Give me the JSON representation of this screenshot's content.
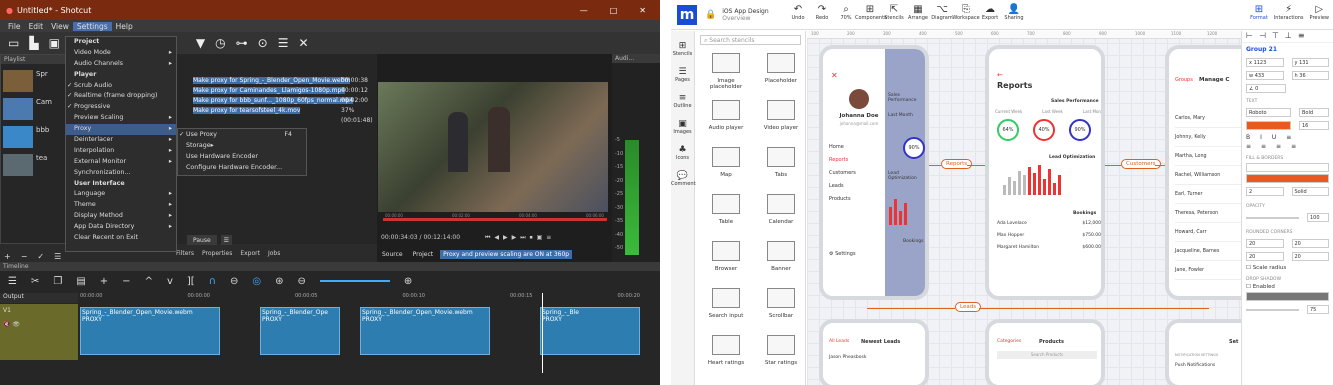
{
  "shotcut": {
    "title": "Untitled* - Shotcut",
    "menu": [
      "File",
      "Edit",
      "View",
      "Settings",
      "Help"
    ],
    "settings_menu": [
      {
        "label": "Project",
        "bold": true
      },
      {
        "label": "Video Mode",
        "arrow": true
      },
      {
        "label": "Audio Channels",
        "arrow": true
      },
      {
        "label": "Player",
        "bold": true
      },
      {
        "label": "Scrub Audio",
        "check": true
      },
      {
        "label": "Realtime (frame dropping)",
        "check": true
      },
      {
        "label": "Progressive",
        "check": true
      },
      {
        "label": "Preview Scaling",
        "arrow": true
      },
      {
        "label": "Proxy",
        "arrow": true,
        "selected": true
      },
      {
        "label": "Deinterlacer",
        "arrow": true
      },
      {
        "label": "Interpolation",
        "arrow": true
      },
      {
        "label": "External Monitor",
        "arrow": true
      },
      {
        "label": "Synchronization..."
      },
      {
        "label": "User Interface",
        "bold": true
      },
      {
        "label": "Language",
        "arrow": true
      },
      {
        "label": "Theme",
        "arrow": true
      },
      {
        "label": "Display Method",
        "arrow": true
      },
      {
        "label": "App Data Directory",
        "arrow": true
      },
      {
        "label": "Clear Recent on Exit"
      }
    ],
    "proxy_submenu": [
      {
        "label": "Use Proxy",
        "shortcut": "F4",
        "check": true
      },
      {
        "label": "Storage",
        "arrow": true,
        "selected": true
      },
      {
        "label": "Use Hardware Encoder"
      },
      {
        "label": "Configure Hardware Encoder..."
      }
    ],
    "jobs": [
      {
        "label": "Make proxy for Spring_-_Blender_Open_Movie.webm",
        "status": "00:00:38"
      },
      {
        "label": "Make proxy for Caminandes_ Llamigos-1080p.mp4",
        "status": "00:00:12"
      },
      {
        "label": "Make proxy for bbb_sunf..._1080p_60fps_normal.mp4",
        "status": "00:02:00"
      },
      {
        "label": "Make proxy for tearsofsteel_4k.mov",
        "status": "37% (00:01:48)"
      }
    ],
    "playlist_label": "Playlist",
    "playlist_items": [
      "Spr",
      "Cam",
      "bbb",
      "tea"
    ],
    "timecode": "00:00:34:03",
    "duration": "/ 00:12:14:00",
    "ruler_times": [
      "00:00:00",
      "00:00:00",
      "00:00:05",
      "00:00:10",
      "00:00:15",
      "00:00:20"
    ],
    "player_ticks": [
      "00:00:00",
      "00:02:00",
      "00:04:00",
      "00:06:00"
    ],
    "tabs": [
      "Filters",
      "Properties",
      "Export",
      "Jobs"
    ],
    "pause": "Pause",
    "source": "Source",
    "project": "Project",
    "proxy_notice": "Proxy and preview scaling are ON at 360p",
    "audio_label": "Audi...",
    "meter_labels": [
      "-5",
      "-10",
      "-15",
      "-20",
      "-25",
      "-30",
      "-35",
      "-40",
      "-50"
    ],
    "timeline_label": "Timeline",
    "output": "Output",
    "track": "V1",
    "clips": [
      "Spring_-_Blender_Open_Movie.webm",
      "Spring_-_Blender_Ope",
      "Spring_-_Blender_Open_Movie.webm",
      "Spring_-_Ble"
    ],
    "clip_sub": "PROXY"
  },
  "moqups": {
    "logo": "m",
    "doc_title": "iOS App Design",
    "doc_sub": "Overview",
    "toolbar": [
      "Undo",
      "Redo",
      "70%",
      "Components",
      "Stencils",
      "Arrange",
      "Diagram",
      "Workspace",
      "Export",
      "Sharing"
    ],
    "right_tabs": [
      "Format",
      "Interactions",
      "Preview"
    ],
    "side_items": [
      "Stencils",
      "Pages",
      "Outline",
      "Images",
      "Icons",
      "Comments"
    ],
    "search": "Search stencils",
    "stencils": [
      "Image placeholder",
      "Placeholder",
      "Audio player",
      "Video player",
      "Map",
      "Tabs",
      "Table",
      "Calendar",
      "Browser",
      "Banner",
      "Search input",
      "Scrollbar",
      "Heart ratings",
      "Star ratings"
    ],
    "ruler": [
      "100",
      "200",
      "300",
      "400",
      "500",
      "600",
      "700",
      "800",
      "900",
      "1000",
      "1100",
      "1200"
    ],
    "phone1": {
      "name": "Johanna Doe",
      "email": "johanna@mail.com",
      "items": [
        "Home",
        "Reports",
        "Customers",
        "Leads",
        "Products",
        "Settings"
      ],
      "peek": "Sales Performance",
      "peek2": "Last Month",
      "peek3": "Lead Optimization",
      "peek4": "Bookings"
    },
    "phone2": {
      "title": "Reports",
      "section": "Sales Performance",
      "rings": [
        "64%",
        "40%",
        "90%"
      ],
      "ring_labels": [
        "Current Week",
        "Last Week",
        "Last Month"
      ],
      "section2": "Lead Optimization",
      "section3": "Bookings",
      "people": [
        "Ada Lovelace",
        "Max Hopper",
        "Margaret Hamilton"
      ],
      "amounts": [
        "$12,000",
        "$750.00",
        "$600.00"
      ]
    },
    "phone3": {
      "tab": "Groups",
      "title": "Manage C",
      "list": [
        "Carlos, Mary",
        "Johnny, Kelly",
        "Martha, Long",
        "Rachel, Williamson",
        "Earl, Turner",
        "Theresa, Peterson",
        "Howard, Carr",
        "Jacqueline, Barnes",
        "Jane, Fowler"
      ]
    },
    "phone4": {
      "back": "All Leads",
      "title": "Newest Leads",
      "item": "Jason Pheasbosk"
    },
    "phone5": {
      "left": "Categories",
      "title": "Products",
      "search": "Search Products"
    },
    "phone6": {
      "title": "Set",
      "sub": "NOTIFICATION SETTINGS",
      "row": "Push Notifications"
    },
    "flows": [
      "Reports",
      "Customers",
      "Leads"
    ],
    "panel": {
      "group": "Group 21",
      "x": "1123",
      "y": "131",
      "w": "433",
      "h": "36",
      "r": "0",
      "text_sec": "TEXT",
      "font": "Roboto",
      "weight": "Bold",
      "size": "16",
      "fill_sec": "FILL & BORDERS",
      "border": "2",
      "style": "Solid",
      "opacity_sec": "OPACITY",
      "opacity": "100",
      "corners_sec": "ROUNDED CORNERS",
      "c": [
        "20",
        "20",
        "20",
        "20"
      ],
      "scale": "Scale radius",
      "shadow_sec": "DROP SHADOW",
      "enabled": "Enabled",
      "shadow_val": "75"
    }
  }
}
